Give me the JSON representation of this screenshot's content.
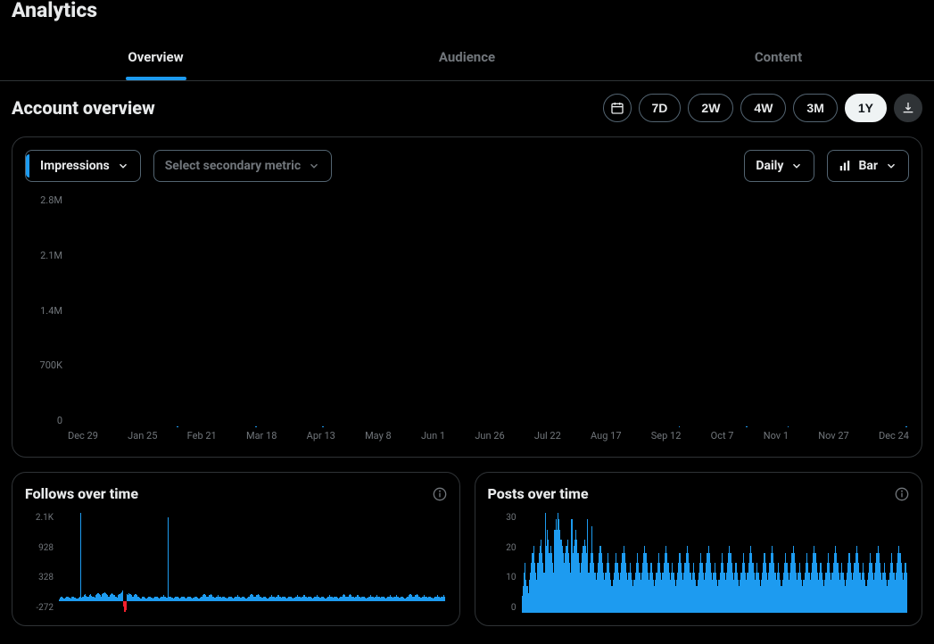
{
  "page_title": "Analytics",
  "tabs": [
    "Overview",
    "Audience",
    "Content"
  ],
  "active_tab": 0,
  "section_title": "Account overview",
  "time_ranges": [
    "7D",
    "2W",
    "4W",
    "3M",
    "1Y"
  ],
  "active_range": 4,
  "primary_metric": "Impressions",
  "secondary_metric_placeholder": "Select secondary metric",
  "granularity": "Daily",
  "chart_type": "Bar",
  "follows_title": "Follows over time",
  "posts_title": "Posts over time",
  "chart_data": {
    "main": {
      "type": "bar",
      "title": "Impressions",
      "ylabel": "",
      "ylim": [
        0,
        2800000
      ],
      "y_ticks": [
        "2.8M",
        "2.1M",
        "1.4M",
        "700K",
        "0"
      ],
      "x_ticks": [
        "Dec 29",
        "Jan 25",
        "Feb 21",
        "Mar 18",
        "Apr 13",
        "May 8",
        "Jun 1",
        "Jun 26",
        "Jul 22",
        "Aug 17",
        "Sep 12",
        "Oct 7",
        "Nov 1",
        "Nov 27",
        "Dec 24"
      ],
      "values": [
        120,
        180,
        280,
        350,
        300,
        220,
        260,
        400,
        450,
        500,
        350,
        300,
        380,
        420,
        350,
        280,
        500,
        550,
        300,
        420,
        380,
        450,
        400,
        350,
        480,
        520,
        440,
        380,
        320,
        450,
        400,
        580,
        620,
        400,
        350,
        300,
        400,
        450,
        500,
        380,
        320,
        280,
        400,
        350,
        300,
        550,
        400,
        2800,
        500,
        420,
        700,
        650,
        800,
        600,
        550,
        700,
        500,
        450,
        800,
        600,
        400,
        700,
        650,
        550,
        480,
        400,
        600,
        550,
        500,
        750,
        650,
        400,
        550,
        480,
        730,
        400,
        350,
        450,
        550,
        620,
        500,
        850,
        450,
        600,
        540,
        380,
        420,
        400,
        380,
        550,
        650,
        600,
        420,
        380,
        450,
        800,
        400,
        350,
        400,
        420,
        380,
        350,
        450,
        500,
        380,
        400,
        350,
        320,
        280,
        300,
        1400,
        420,
        400,
        380,
        360,
        400,
        350,
        320,
        300,
        720,
        350,
        400,
        380,
        350,
        320,
        380,
        300,
        280,
        350,
        400,
        380,
        350,
        420,
        400,
        350,
        300,
        280,
        260,
        300,
        320,
        820,
        300,
        320,
        250,
        260,
        280,
        350,
        320,
        300,
        280,
        260,
        300,
        350,
        380,
        320,
        300,
        280,
        260,
        300,
        380,
        350,
        320,
        300,
        280,
        260,
        300,
        250,
        230,
        320,
        350,
        300,
        320,
        300,
        280,
        260,
        280,
        350,
        300,
        280,
        320,
        350,
        300,
        280,
        260,
        300,
        350,
        380,
        400,
        420,
        380,
        300,
        280,
        350,
        320,
        380,
        400,
        350,
        300,
        280,
        350,
        320,
        300,
        280,
        260,
        300,
        350,
        320,
        300,
        320,
        280,
        300,
        350,
        380,
        320,
        300,
        280,
        260,
        300,
        350,
        400,
        380,
        320,
        300,
        350,
        320,
        300,
        280,
        350,
        400,
        380,
        350,
        320,
        300,
        280,
        260,
        300,
        320,
        350,
        380,
        400,
        380,
        350,
        320,
        300,
        350,
        380,
        400,
        420,
        380,
        350,
        320,
        350,
        300,
        280,
        320,
        350,
        400,
        420,
        380,
        350,
        320,
        300,
        350,
        380,
        850,
        400,
        380,
        350,
        300,
        280,
        320,
        350,
        380,
        420,
        500,
        380,
        350,
        320,
        350,
        400,
        420,
        380,
        260,
        290,
        260,
        300,
        370,
        400,
        430,
        380,
        350,
        320,
        350,
        880,
        650,
        550,
        300,
        780,
        360,
        380,
        400,
        350,
        320,
        300,
        280,
        350,
        380,
        770,
        400,
        420,
        500,
        900,
        460,
        350,
        320,
        300,
        350,
        780,
        400,
        380,
        350,
        600,
        300,
        350,
        380,
        400,
        420,
        380,
        350,
        320,
        300,
        350,
        380,
        400,
        420,
        380,
        350,
        320,
        350,
        380,
        400,
        330,
        340,
        300,
        320,
        340,
        360,
        400,
        350,
        560,
        400,
        350,
        320,
        350,
        380,
        400,
        420,
        380,
        350,
        320,
        350,
        380,
        1580
      ]
    },
    "follows": {
      "type": "bar",
      "title": "Follows over time",
      "y_ticks": [
        "2.1K",
        "928",
        "328",
        "-272"
      ],
      "ylim": [
        -272,
        2100
      ],
      "values": [
        50,
        80,
        120,
        90,
        70,
        60,
        80,
        100,
        120,
        90,
        80,
        70,
        100,
        120,
        90,
        80,
        70,
        60,
        80,
        100,
        2100,
        90,
        120,
        150,
        180,
        140,
        120,
        100,
        150,
        170,
        140,
        120,
        100,
        90,
        150,
        180,
        200,
        180,
        150,
        120,
        180,
        200,
        220,
        200,
        180,
        150,
        120,
        150,
        180,
        200,
        180,
        150,
        120,
        100,
        80,
        150,
        180,
        200,
        220,
        250,
        -120,
        -250,
        -200,
        180,
        150,
        200,
        180,
        150,
        120,
        100,
        150,
        180,
        150,
        120,
        100,
        80,
        60,
        100,
        120,
        100,
        80,
        60,
        80,
        100,
        120,
        100,
        80,
        60,
        80,
        100,
        120,
        100,
        80,
        60,
        80,
        100,
        120,
        150,
        120,
        100,
        80,
        2000,
        100,
        120,
        100,
        80,
        60,
        80,
        100,
        120,
        100,
        80,
        60,
        80,
        100,
        120,
        100,
        80,
        60,
        80,
        100,
        120,
        100,
        80,
        60,
        80,
        100,
        120,
        100,
        80,
        60,
        80,
        100,
        120,
        150,
        180,
        150,
        120,
        100,
        120,
        150,
        180,
        150,
        120,
        100,
        80,
        100,
        120,
        150,
        120,
        100,
        80,
        100,
        120,
        100,
        80,
        60,
        80,
        100,
        120,
        100,
        80,
        60,
        80,
        100,
        120,
        150,
        120,
        100,
        80,
        100,
        120,
        100,
        80,
        60,
        80,
        100,
        120,
        150,
        180,
        150,
        120,
        100,
        120,
        150,
        180,
        150,
        120,
        100,
        80,
        100,
        120,
        100,
        80,
        60,
        80,
        100,
        120,
        150,
        120,
        100,
        80,
        100,
        120,
        150,
        120,
        100,
        80,
        100,
        120,
        100,
        80,
        60,
        80,
        100,
        120,
        100,
        80,
        60,
        80,
        100,
        120,
        150,
        120,
        100,
        80,
        100,
        120,
        150,
        120,
        100,
        80,
        100,
        120,
        100,
        80,
        60,
        80,
        100,
        120,
        150,
        120,
        100,
        80,
        100,
        120,
        100,
        80,
        60,
        80,
        100,
        120,
        150,
        120,
        100,
        80,
        100,
        120,
        100,
        80,
        60,
        80,
        100,
        120,
        150,
        180,
        150,
        120,
        100,
        120,
        150,
        180,
        150,
        120,
        100,
        80,
        100,
        120,
        150,
        120,
        100,
        80,
        100,
        120,
        100,
        80,
        60,
        80,
        100,
        120,
        150,
        120,
        100,
        80,
        100,
        120,
        150,
        120,
        100,
        80,
        100,
        120,
        100,
        80,
        60,
        80,
        100,
        120,
        150,
        120,
        100,
        80,
        100,
        120,
        150,
        120,
        100,
        80,
        100,
        120,
        100,
        80,
        60,
        80,
        100,
        120,
        150,
        180,
        150,
        120,
        100,
        120,
        150,
        180,
        150,
        120,
        100,
        80,
        100,
        120,
        150,
        120,
        100,
        80,
        100,
        120,
        100,
        80,
        60,
        80,
        100,
        120,
        150,
        120,
        100,
        80,
        100,
        120,
        150,
        120
      ]
    },
    "posts": {
      "type": "bar",
      "title": "Posts over time",
      "y_ticks": [
        "30",
        "20",
        "10",
        "0"
      ],
      "ylim": [
        0,
        30
      ],
      "values": [
        5,
        8,
        12,
        15,
        10,
        8,
        6,
        10,
        12,
        15,
        18,
        20,
        15,
        12,
        10,
        15,
        18,
        20,
        22,
        18,
        15,
        12,
        30,
        20,
        25,
        22,
        18,
        20,
        18,
        15,
        12,
        25,
        28,
        25,
        30,
        28,
        25,
        22,
        20,
        18,
        15,
        18,
        20,
        22,
        18,
        15,
        12,
        28,
        18,
        20,
        22,
        25,
        22,
        18,
        15,
        12,
        15,
        18,
        20,
        22,
        20,
        18,
        28,
        12,
        15,
        18,
        26,
        18,
        15,
        12,
        10,
        12,
        15,
        18,
        20,
        18,
        15,
        12,
        10,
        12,
        15,
        18,
        15,
        12,
        10,
        8,
        10,
        12,
        15,
        18,
        15,
        12,
        10,
        12,
        15,
        18,
        20,
        18,
        15,
        12,
        10,
        12,
        15,
        12,
        10,
        8,
        10,
        12,
        15,
        18,
        15,
        12,
        10,
        12,
        15,
        18,
        20,
        18,
        15,
        12,
        10,
        12,
        15,
        12,
        10,
        8,
        10,
        12,
        15,
        18,
        15,
        12,
        10,
        12,
        15,
        18,
        20,
        18,
        15,
        12,
        10,
        12,
        15,
        12,
        10,
        8,
        10,
        12,
        15,
        18,
        15,
        12,
        10,
        12,
        15,
        18,
        20,
        18,
        15,
        12,
        10,
        12,
        15,
        12,
        10,
        8,
        10,
        12,
        15,
        18,
        15,
        12,
        10,
        12,
        15,
        18,
        20,
        18,
        15,
        12,
        10,
        12,
        15,
        12,
        10,
        8,
        10,
        12,
        15,
        18,
        15,
        12,
        10,
        12,
        15,
        18,
        20,
        18,
        15,
        12,
        10,
        12,
        15,
        12,
        10,
        8,
        10,
        12,
        15,
        18,
        15,
        12,
        10,
        12,
        15,
        18,
        20,
        18,
        15,
        12,
        10,
        12,
        15,
        12,
        10,
        8,
        10,
        12,
        15,
        18,
        15,
        12,
        10,
        12,
        15,
        18,
        20,
        18,
        15,
        12,
        10,
        12,
        15,
        12,
        10,
        8,
        10,
        12,
        15,
        18,
        15,
        12,
        10,
        12,
        15,
        18,
        20,
        18,
        15,
        12,
        10,
        12,
        15,
        12,
        10,
        8,
        10,
        12,
        15,
        18,
        15,
        12,
        10,
        12,
        15,
        18,
        20,
        18,
        15,
        12,
        10,
        12,
        15,
        12,
        10,
        8,
        10,
        12,
        15,
        18,
        15,
        12,
        10,
        12,
        15,
        18,
        20,
        18,
        15,
        12,
        10,
        12,
        15,
        12,
        10,
        8,
        10,
        12,
        15,
        18,
        15,
        12,
        10,
        12,
        15,
        18,
        20,
        18,
        15,
        12,
        10,
        12,
        15,
        12,
        10,
        8,
        10,
        12,
        15,
        18,
        15,
        12,
        10,
        12,
        15,
        18,
        20,
        18,
        15,
        12,
        10,
        12,
        15,
        12,
        10,
        8,
        10,
        12,
        15,
        18,
        15,
        12,
        10,
        12,
        15,
        18,
        20,
        18,
        15,
        12,
        10,
        12,
        15,
        12
      ]
    }
  }
}
